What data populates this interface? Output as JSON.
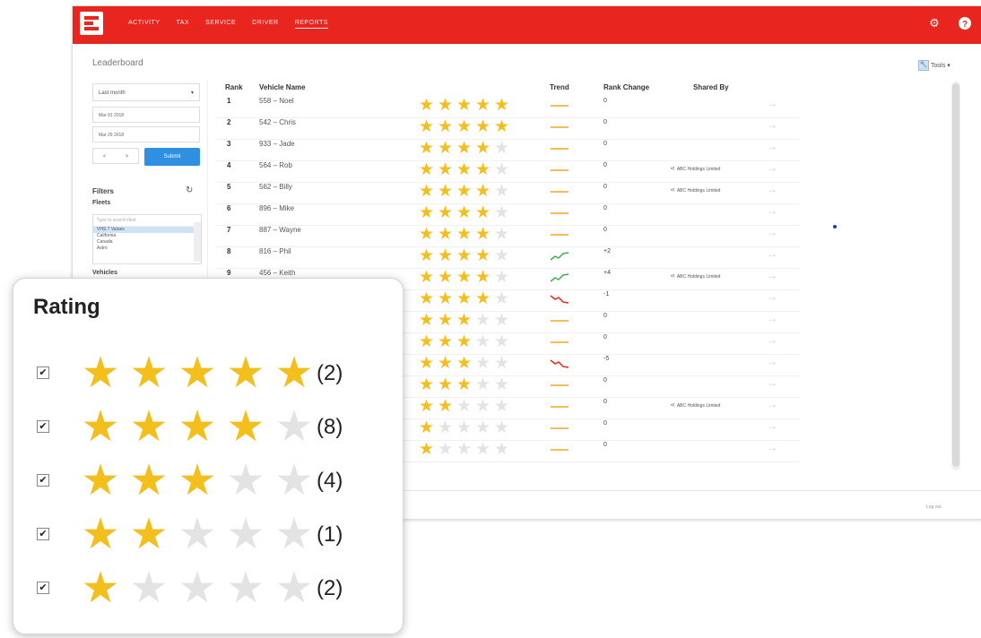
{
  "nav": {
    "items": [
      {
        "label": "ACTIVITY",
        "active": false
      },
      {
        "label": "TAX",
        "active": false
      },
      {
        "label": "SERVICE",
        "active": false
      },
      {
        "label": "DRIVER",
        "active": false
      },
      {
        "label": "REPORTS",
        "active": true
      }
    ],
    "settings_icon": "gear-icon",
    "help_icon": "question-icon"
  },
  "page": {
    "title": "Leaderboard",
    "tools_label": "Tools",
    "tools_icon": "wrench-icon"
  },
  "sidebar": {
    "period": "Last month",
    "date_from": "Mar 01 2018",
    "date_to": "Mar 29 2018",
    "stepper": [
      "<",
      ">"
    ],
    "submit_label": "Submit",
    "filters_label": "Filters",
    "fleets_label": "Fleets",
    "fleet_search_placeholder": "Type to search fleet",
    "fleet_options": [
      "VHS 7 Values",
      "California",
      "Canada",
      "Astro"
    ],
    "vehicles_label": "Vehicles"
  },
  "table": {
    "headers": {
      "rank": "Rank",
      "name": "Vehicle Name",
      "trend": "Trend",
      "change": "Rank Change",
      "shared": "Shared By"
    },
    "rows": [
      {
        "rank": "1",
        "name": "558 – Noel",
        "stars": 5,
        "trend": "flat",
        "change": "0",
        "shared": ""
      },
      {
        "rank": "2",
        "name": "542 – Chris",
        "stars": 5,
        "trend": "flat",
        "change": "0",
        "shared": ""
      },
      {
        "rank": "3",
        "name": "933 – Jade",
        "stars": 4,
        "trend": "flat",
        "change": "0",
        "shared": ""
      },
      {
        "rank": "4",
        "name": "564 – Rob",
        "stars": 4,
        "trend": "flat",
        "change": "0",
        "shared": "ABC Holdings Limited"
      },
      {
        "rank": "5",
        "name": "562 – Billy",
        "stars": 4,
        "trend": "flat",
        "change": "0",
        "shared": "ABC Holdings Limited"
      },
      {
        "rank": "6",
        "name": "896 – Mike",
        "stars": 4,
        "trend": "flat",
        "change": "0",
        "shared": ""
      },
      {
        "rank": "7",
        "name": "887 – Wayne",
        "stars": 4,
        "trend": "flat",
        "change": "0",
        "shared": ""
      },
      {
        "rank": "8",
        "name": "816 – Phil",
        "stars": 4,
        "trend": "up",
        "change": "+2",
        "shared": ""
      },
      {
        "rank": "9",
        "name": "456 – Keith",
        "stars": 4,
        "trend": "up",
        "change": "+4",
        "shared": "ABC Holdings Limited"
      },
      {
        "rank": "",
        "name": "",
        "stars": 4,
        "trend": "down",
        "change": "-1",
        "shared": ""
      },
      {
        "rank": "",
        "name": "",
        "stars": 3,
        "trend": "flat",
        "change": "0",
        "shared": ""
      },
      {
        "rank": "",
        "name": "",
        "stars": 3,
        "trend": "flat",
        "change": "0",
        "shared": ""
      },
      {
        "rank": "",
        "name": "",
        "stars": 3,
        "trend": "down",
        "change": "-5",
        "shared": ""
      },
      {
        "rank": "",
        "name": "",
        "stars": 3,
        "trend": "flat",
        "change": "0",
        "shared": ""
      },
      {
        "rank": "",
        "name": "",
        "stars": 2,
        "trend": "flat",
        "change": "0",
        "shared": "ABC Holdings Limited"
      },
      {
        "rank": "",
        "name": "",
        "stars": 1,
        "trend": "flat",
        "change": "0",
        "shared": ""
      },
      {
        "rank": "",
        "name": "",
        "stars": 1,
        "trend": "flat",
        "change": "0",
        "shared": ""
      }
    ]
  },
  "footer": {
    "text": "Log out"
  },
  "rating_panel": {
    "title": "Rating",
    "rows": [
      {
        "stars": 5,
        "count": "(2)",
        "checked": true
      },
      {
        "stars": 4,
        "count": "(8)",
        "checked": true
      },
      {
        "stars": 3,
        "count": "(4)",
        "checked": true
      },
      {
        "stars": 2,
        "count": "(1)",
        "checked": true
      },
      {
        "stars": 1,
        "count": "(2)",
        "checked": true
      }
    ]
  },
  "colors": {
    "brand": "#e8261f",
    "star_on": "#f2bf1d",
    "star_off": "#e3e3e3",
    "trend_flat": "#f5a623",
    "trend_up": "#3bb34a",
    "trend_down": "#e8261f",
    "submit": "#2f8fe0"
  }
}
